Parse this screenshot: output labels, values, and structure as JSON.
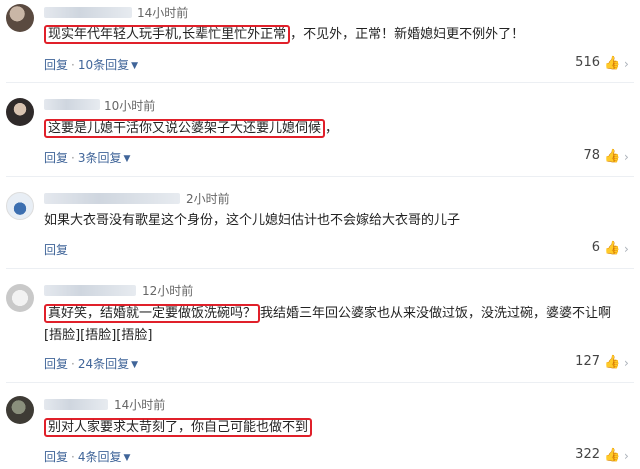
{
  "comments": [
    {
      "time": "14小时前",
      "highlighted": "现实年代年轻人玩手机,长辈忙里忙外正常",
      "text_rest": "，不见外，正常！新婚媳妇更不例外了！",
      "reply": "回复",
      "replies": "10条回复",
      "likes": "516"
    },
    {
      "time": "10小时前",
      "highlighted": "这要是儿媳干活你又说公婆架子大还要儿媳伺候",
      "text_rest": "，",
      "reply": "回复",
      "replies": "3条回复",
      "likes": "78"
    },
    {
      "time": "2小时前",
      "highlighted": "",
      "text_rest": "如果大衣哥没有歌星这个身份，这个儿媳妇估计也不会嫁给大衣哥的儿子",
      "reply": "回复",
      "replies": "",
      "likes": "6"
    },
    {
      "time": "12小时前",
      "highlighted": "真好笑，结婚就一定要做饭洗碗吗？",
      "text_rest": "我结婚三年回公婆家也从来没做过饭，没洗过碗，婆婆不让啊",
      "text_line2": "[捂脸][捂脸][捂脸]",
      "reply": "回复",
      "replies": "24条回复",
      "likes": "127"
    },
    {
      "time": "14小时前",
      "highlighted": "别对人家要求太苛刻了，你自己可能也做不到",
      "text_rest": "",
      "reply": "回复",
      "replies": "4条回复",
      "likes": "322"
    }
  ],
  "icons": {
    "like": "thumbs-up-icon",
    "more": "chevron-right-icon",
    "expand": "chevron-down-icon"
  },
  "colors": {
    "highlight_border": "#e0202a",
    "link": "#406599"
  }
}
